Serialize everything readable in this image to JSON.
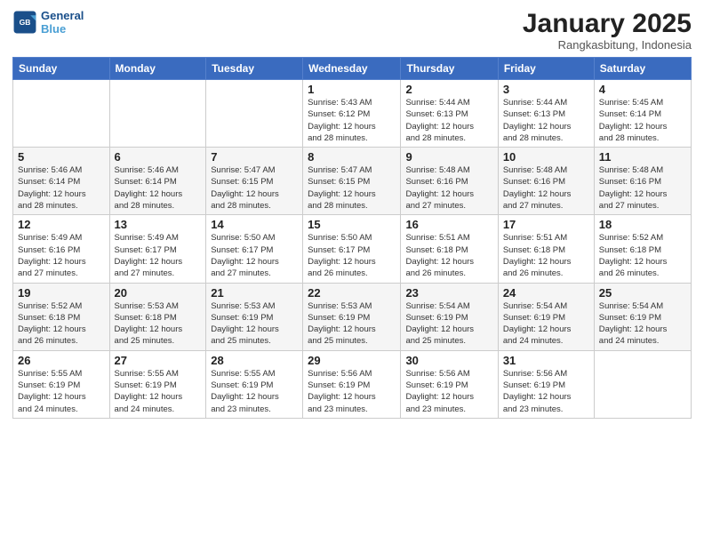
{
  "header": {
    "logo_line1": "General",
    "logo_line2": "Blue",
    "month": "January 2025",
    "location": "Rangkasbitung, Indonesia"
  },
  "weekdays": [
    "Sunday",
    "Monday",
    "Tuesday",
    "Wednesday",
    "Thursday",
    "Friday",
    "Saturday"
  ],
  "weeks": [
    [
      {
        "day": "",
        "info": ""
      },
      {
        "day": "",
        "info": ""
      },
      {
        "day": "",
        "info": ""
      },
      {
        "day": "1",
        "info": "Sunrise: 5:43 AM\nSunset: 6:12 PM\nDaylight: 12 hours\nand 28 minutes."
      },
      {
        "day": "2",
        "info": "Sunrise: 5:44 AM\nSunset: 6:13 PM\nDaylight: 12 hours\nand 28 minutes."
      },
      {
        "day": "3",
        "info": "Sunrise: 5:44 AM\nSunset: 6:13 PM\nDaylight: 12 hours\nand 28 minutes."
      },
      {
        "day": "4",
        "info": "Sunrise: 5:45 AM\nSunset: 6:14 PM\nDaylight: 12 hours\nand 28 minutes."
      }
    ],
    [
      {
        "day": "5",
        "info": "Sunrise: 5:46 AM\nSunset: 6:14 PM\nDaylight: 12 hours\nand 28 minutes."
      },
      {
        "day": "6",
        "info": "Sunrise: 5:46 AM\nSunset: 6:14 PM\nDaylight: 12 hours\nand 28 minutes."
      },
      {
        "day": "7",
        "info": "Sunrise: 5:47 AM\nSunset: 6:15 PM\nDaylight: 12 hours\nand 28 minutes."
      },
      {
        "day": "8",
        "info": "Sunrise: 5:47 AM\nSunset: 6:15 PM\nDaylight: 12 hours\nand 28 minutes."
      },
      {
        "day": "9",
        "info": "Sunrise: 5:48 AM\nSunset: 6:16 PM\nDaylight: 12 hours\nand 27 minutes."
      },
      {
        "day": "10",
        "info": "Sunrise: 5:48 AM\nSunset: 6:16 PM\nDaylight: 12 hours\nand 27 minutes."
      },
      {
        "day": "11",
        "info": "Sunrise: 5:48 AM\nSunset: 6:16 PM\nDaylight: 12 hours\nand 27 minutes."
      }
    ],
    [
      {
        "day": "12",
        "info": "Sunrise: 5:49 AM\nSunset: 6:16 PM\nDaylight: 12 hours\nand 27 minutes."
      },
      {
        "day": "13",
        "info": "Sunrise: 5:49 AM\nSunset: 6:17 PM\nDaylight: 12 hours\nand 27 minutes."
      },
      {
        "day": "14",
        "info": "Sunrise: 5:50 AM\nSunset: 6:17 PM\nDaylight: 12 hours\nand 27 minutes."
      },
      {
        "day": "15",
        "info": "Sunrise: 5:50 AM\nSunset: 6:17 PM\nDaylight: 12 hours\nand 26 minutes."
      },
      {
        "day": "16",
        "info": "Sunrise: 5:51 AM\nSunset: 6:18 PM\nDaylight: 12 hours\nand 26 minutes."
      },
      {
        "day": "17",
        "info": "Sunrise: 5:51 AM\nSunset: 6:18 PM\nDaylight: 12 hours\nand 26 minutes."
      },
      {
        "day": "18",
        "info": "Sunrise: 5:52 AM\nSunset: 6:18 PM\nDaylight: 12 hours\nand 26 minutes."
      }
    ],
    [
      {
        "day": "19",
        "info": "Sunrise: 5:52 AM\nSunset: 6:18 PM\nDaylight: 12 hours\nand 26 minutes."
      },
      {
        "day": "20",
        "info": "Sunrise: 5:53 AM\nSunset: 6:18 PM\nDaylight: 12 hours\nand 25 minutes."
      },
      {
        "day": "21",
        "info": "Sunrise: 5:53 AM\nSunset: 6:19 PM\nDaylight: 12 hours\nand 25 minutes."
      },
      {
        "day": "22",
        "info": "Sunrise: 5:53 AM\nSunset: 6:19 PM\nDaylight: 12 hours\nand 25 minutes."
      },
      {
        "day": "23",
        "info": "Sunrise: 5:54 AM\nSunset: 6:19 PM\nDaylight: 12 hours\nand 25 minutes."
      },
      {
        "day": "24",
        "info": "Sunrise: 5:54 AM\nSunset: 6:19 PM\nDaylight: 12 hours\nand 24 minutes."
      },
      {
        "day": "25",
        "info": "Sunrise: 5:54 AM\nSunset: 6:19 PM\nDaylight: 12 hours\nand 24 minutes."
      }
    ],
    [
      {
        "day": "26",
        "info": "Sunrise: 5:55 AM\nSunset: 6:19 PM\nDaylight: 12 hours\nand 24 minutes."
      },
      {
        "day": "27",
        "info": "Sunrise: 5:55 AM\nSunset: 6:19 PM\nDaylight: 12 hours\nand 24 minutes."
      },
      {
        "day": "28",
        "info": "Sunrise: 5:55 AM\nSunset: 6:19 PM\nDaylight: 12 hours\nand 23 minutes."
      },
      {
        "day": "29",
        "info": "Sunrise: 5:56 AM\nSunset: 6:19 PM\nDaylight: 12 hours\nand 23 minutes."
      },
      {
        "day": "30",
        "info": "Sunrise: 5:56 AM\nSunset: 6:19 PM\nDaylight: 12 hours\nand 23 minutes."
      },
      {
        "day": "31",
        "info": "Sunrise: 5:56 AM\nSunset: 6:19 PM\nDaylight: 12 hours\nand 23 minutes."
      },
      {
        "day": "",
        "info": ""
      }
    ]
  ]
}
